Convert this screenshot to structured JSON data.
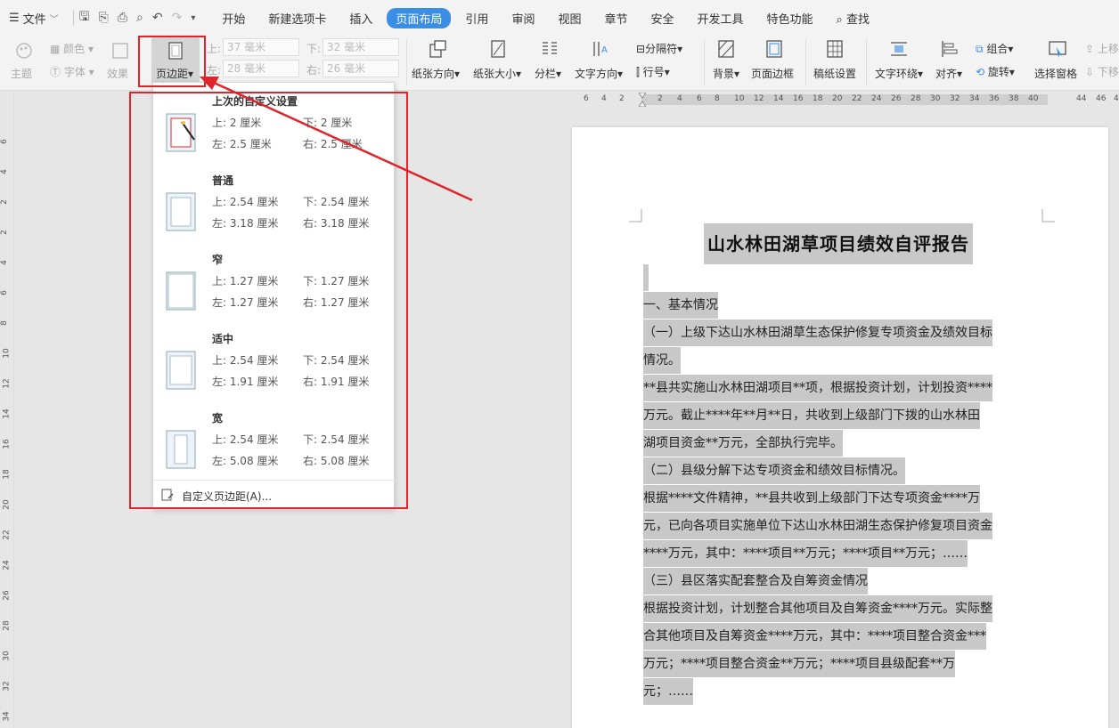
{
  "menubar": {
    "file_label": "文件",
    "tabs": [
      {
        "label": "开始"
      },
      {
        "label": "新建选项卡"
      },
      {
        "label": "插入"
      },
      {
        "label": "页面布局"
      },
      {
        "label": "引用"
      },
      {
        "label": "审阅"
      },
      {
        "label": "视图"
      },
      {
        "label": "章节"
      },
      {
        "label": "安全"
      },
      {
        "label": "开发工具"
      },
      {
        "label": "特色功能"
      }
    ],
    "search_label": "查找",
    "active_tab": "页面布局"
  },
  "ribbon": {
    "theme_label": "主题",
    "colors_label": "颜色",
    "fonts_label": "字体",
    "effects_label": "效果",
    "margins_label": "页边距",
    "top_label": "上:",
    "top_value": "37 毫米",
    "left_label": "左:",
    "left_value": "28 毫米",
    "bottom_label": "下:",
    "bottom_value": "32 毫米",
    "right_label": "右:",
    "right_value": "26 毫米",
    "orientation_label": "纸张方向",
    "size_label": "纸张大小",
    "columns_label": "分栏",
    "text_direction_label": "文字方向",
    "breaks_label": "分隔符",
    "line_numbers_label": "行号",
    "background_label": "背景",
    "page_border_label": "页面边框",
    "grid_paper_label": "稿纸设置",
    "wrap_label": "文字环绕",
    "align_label": "对齐",
    "group_label": "组合",
    "rotate_label": "旋转",
    "selection_pane_label": "选择窗格",
    "bring_forward_label": "上移",
    "send_backward_label": "下移"
  },
  "ruler": {
    "h_ticks": [
      "6",
      "4",
      "2",
      "2",
      "4",
      "6",
      "8",
      "10",
      "12",
      "14",
      "16",
      "18",
      "20",
      "22",
      "24",
      "26",
      "28",
      "30",
      "32",
      "34",
      "36",
      "38",
      "40",
      "44",
      "46",
      "48"
    ],
    "v_ticks": [
      "6",
      "4",
      "2",
      "2",
      "4",
      "6",
      "8",
      "10",
      "12",
      "14",
      "16",
      "18",
      "20",
      "22",
      "24",
      "26",
      "28",
      "30",
      "32",
      "34"
    ]
  },
  "margins_menu": {
    "presets": [
      {
        "name": "上次的自定义设置",
        "top": "上: 2 厘米",
        "bottom": "下: 2 厘米",
        "left": "左: 2.5 厘米",
        "right": "右: 2.5 厘米"
      },
      {
        "name": "普通",
        "top": "上: 2.54 厘米",
        "bottom": "下: 2.54 厘米",
        "left": "左: 3.18 厘米",
        "right": "右: 3.18 厘米"
      },
      {
        "name": "窄",
        "top": "上: 1.27 厘米",
        "bottom": "下: 1.27 厘米",
        "left": "左: 1.27 厘米",
        "right": "右: 1.27 厘米"
      },
      {
        "name": "适中",
        "top": "上: 2.54 厘米",
        "bottom": "下: 2.54 厘米",
        "left": "左: 1.91 厘米",
        "right": "右: 1.91 厘米"
      },
      {
        "name": "宽",
        "top": "上: 2.54 厘米",
        "bottom": "下: 2.54 厘米",
        "left": "左: 5.08 厘米",
        "right": "右: 5.08 厘米"
      }
    ],
    "custom_label": "自定义页边距(A)..."
  },
  "document": {
    "title": "山水林田湖草项目绩效自评报告",
    "lines": [
      "",
      "一、基本情况",
      "（一）上级下达山水林田湖草生态保护修复专项资金及绩效目标",
      "情况。",
      "**县共实施山水林田湖项目**项，根据投资计划，计划投资****",
      "万元。截止****年**月**日，共收到上级部门下拨的山水林田",
      "湖项目资金**万元，全部执行完毕。",
      "（二）县级分解下达专项资金和绩效目标情况。",
      "根据****文件精神，**县共收到上级部门下达专项资金****万",
      "元，已向各项目实施单位下达山水林田湖生态保护修复项目资金",
      "****万元，其中：****项目**万元；****项目**万元；……",
      "（三）县区落实配套整合及自筹资金情况",
      "根据投资计划，计划整合其他项目及自筹资金****万元。实际整",
      "合其他项目及自筹资金****万元，其中：****项目整合资金***",
      "万元；****项目整合资金**万元；****项目县级配套**万",
      "元；……"
    ]
  },
  "colors": {
    "accent": "#3a8ee6",
    "annotation_red": "#e0242b",
    "selection_gray": "#c8c8c8"
  }
}
